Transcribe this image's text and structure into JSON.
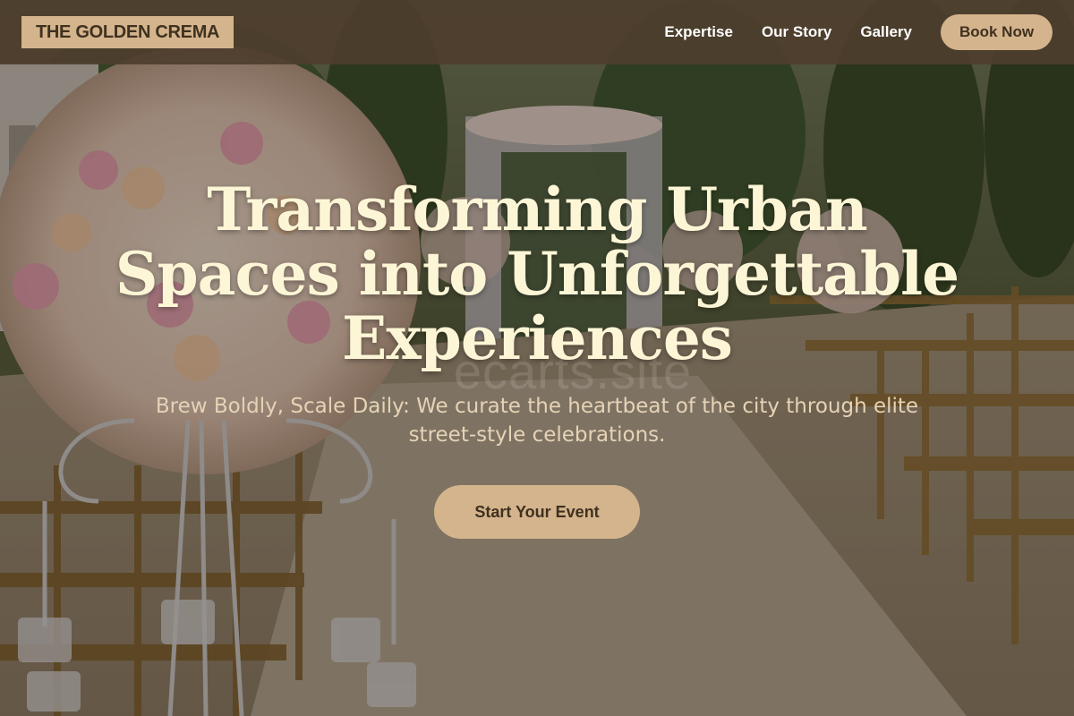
{
  "brand": {
    "logo_text": "THE GOLDEN CREMA"
  },
  "nav": {
    "items": [
      {
        "label": "Expertise"
      },
      {
        "label": "Our Story"
      },
      {
        "label": "Gallery"
      }
    ],
    "book_label": "Book Now"
  },
  "hero": {
    "title": "Transforming Urban Spaces into Unforgettable Experiences",
    "subtitle": "Brew Boldly, Scale Daily: We curate the heartbeat of the city through elite street-style celebrations.",
    "cta_label": "Start Your Event",
    "watermark": "ecarts.site"
  },
  "colors": {
    "header_bg": "#4e3e2e",
    "accent": "#d4b48c",
    "accent_text": "#3f3120",
    "title": "#fdf6d6",
    "subtitle": "#e6d3b6"
  }
}
